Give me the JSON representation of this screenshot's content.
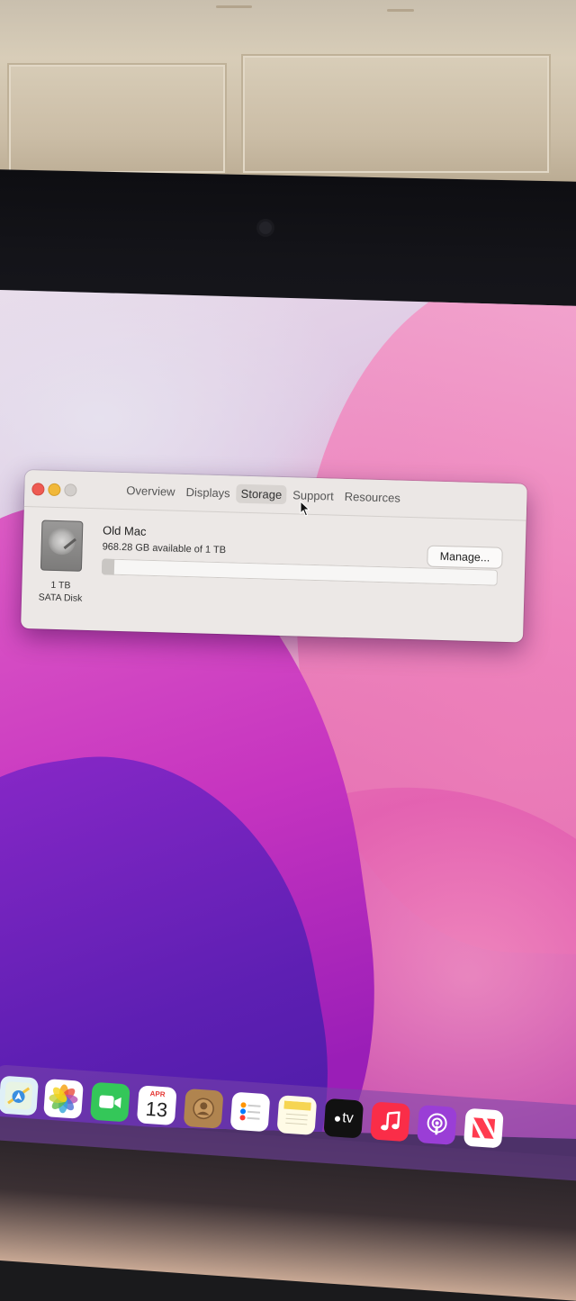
{
  "window": {
    "tabs": [
      "Overview",
      "Displays",
      "Storage",
      "Support",
      "Resources"
    ],
    "active_tab": "Storage",
    "disk": {
      "capacity": "1 TB",
      "type": "SATA Disk"
    },
    "volume": {
      "name": "Old Mac",
      "availability": "968.28 GB available of 1 TB",
      "used_fraction": 0.032
    },
    "manage_label": "Manage..."
  },
  "dock": {
    "items": [
      {
        "name": "maps",
        "color": "#3a9be8"
      },
      {
        "name": "photos",
        "color": "#ffffff"
      },
      {
        "name": "facetime",
        "color": "#2fc84f"
      },
      {
        "name": "calendar",
        "color": "#ffffff",
        "month": "APR",
        "day": "13"
      },
      {
        "name": "contacts",
        "color": "#a57b4b"
      },
      {
        "name": "reminders",
        "color": "#ffffff"
      },
      {
        "name": "notes",
        "color": "#f6d552"
      },
      {
        "name": "tv",
        "color": "#111111",
        "label": "tv"
      },
      {
        "name": "music",
        "color": "#fa2d48"
      },
      {
        "name": "podcasts",
        "color": "#9a3ed6"
      },
      {
        "name": "news",
        "color": "#ffffff"
      }
    ]
  }
}
